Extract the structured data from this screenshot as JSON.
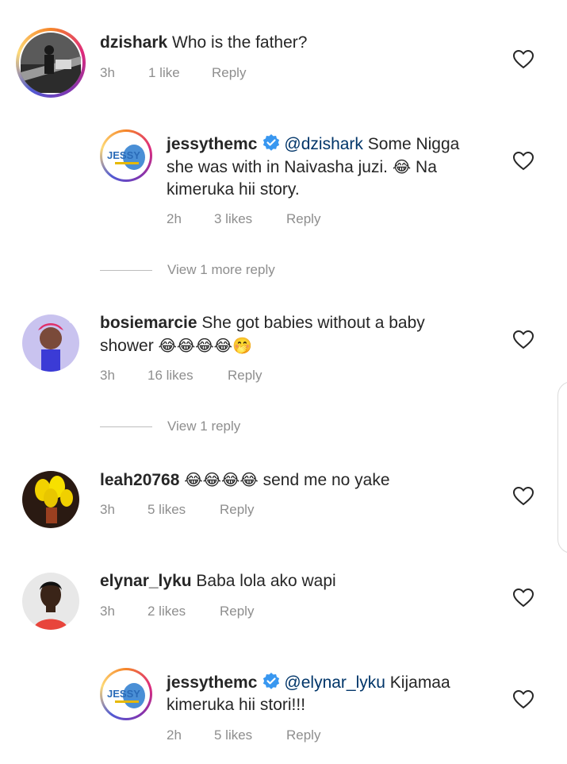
{
  "comments": [
    {
      "username": "dzishark",
      "text": "Who is the father?",
      "time": "3h",
      "likes": "1 like",
      "reply": "Reply"
    },
    {
      "username": "jessythemc",
      "mention": "@dzishark",
      "text_line1": "Some Nigga",
      "text_line2": "she was with in Naivasha juzi.",
      "text_line2b": "Na",
      "text_line3": "kimeruka hii story.",
      "time": "2h",
      "likes": "3 likes",
      "reply": "Reply"
    },
    {
      "username": "bosiemarcie",
      "text_line1": "She got babies without a baby",
      "text_line2": "shower",
      "time": "3h",
      "likes": "16 likes",
      "reply": "Reply"
    },
    {
      "username": "leah20768",
      "text": "send me no yake",
      "time": "3h",
      "likes": "5 likes",
      "reply": "Reply"
    },
    {
      "username": "elynar_lyku",
      "text": "Baba lola ako wapi",
      "time": "3h",
      "likes": "2 likes",
      "reply": "Reply"
    },
    {
      "username": "jessythemc",
      "mention": "@elynar_lyku",
      "text_line1": "Kijamaa",
      "text_line2": "kimeruka hii stori!!!",
      "time": "2h",
      "likes": "5 likes",
      "reply": "Reply"
    }
  ],
  "view_replies": [
    "View 1 more reply",
    "View 1 reply"
  ],
  "logo_text": "JESSY",
  "colors": {
    "verified": "#3897f0",
    "mention": "#003569",
    "meta": "#8e8e8e"
  },
  "icons": {
    "like": "heart-outline-icon",
    "verified": "verified-badge-icon"
  }
}
